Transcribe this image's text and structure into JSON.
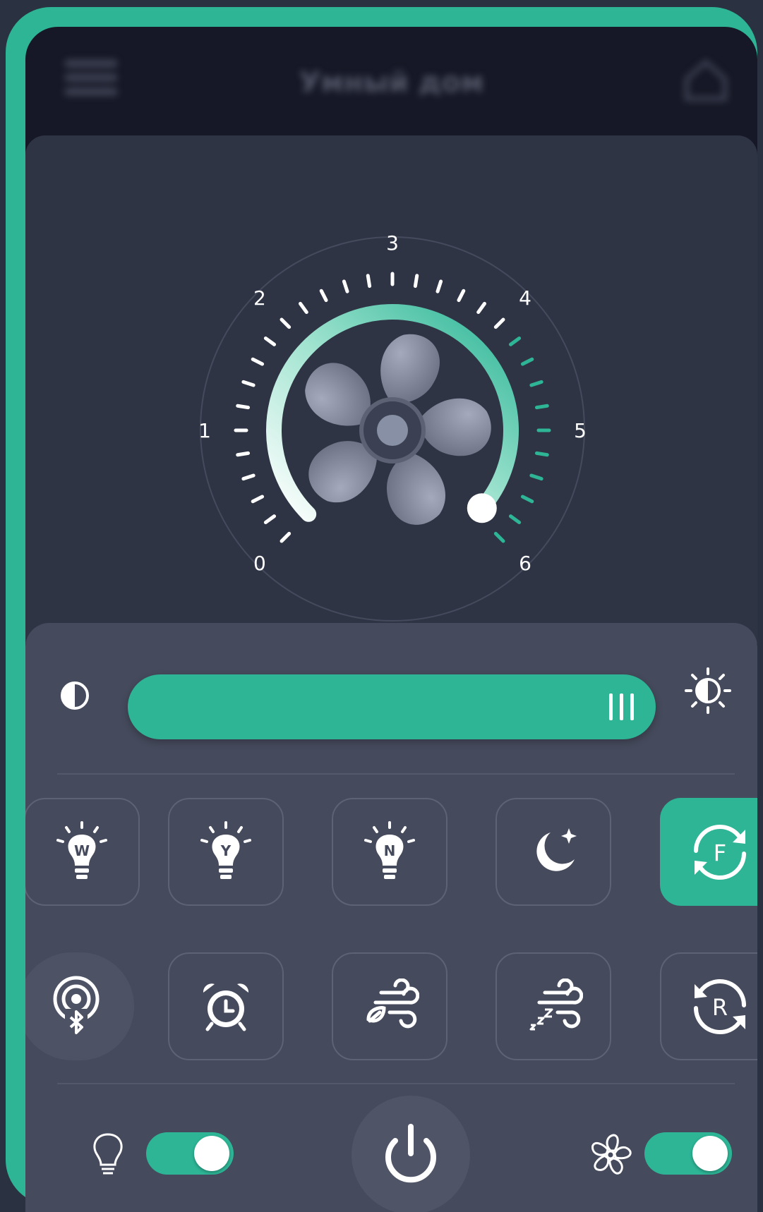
{
  "header": {
    "title": "Умный дом",
    "menu_icon": "hamburger-menu-icon",
    "home_icon": "home-icon"
  },
  "speed_dial": {
    "scale_labels": [
      "0",
      "1",
      "2",
      "3",
      "4",
      "5",
      "6"
    ],
    "min": 0,
    "max": 6,
    "value": 6,
    "center_icon": "fan-icon"
  },
  "brightness": {
    "low_icon": "brightness-low-icon",
    "high_icon": "brightness-high-icon",
    "value_fraction": 1.0
  },
  "mode_buttons_row1": [
    {
      "name": "light-w-button",
      "icon": "bulb-icon",
      "label": "W"
    },
    {
      "name": "light-y-button",
      "icon": "bulb-icon",
      "label": "Y"
    },
    {
      "name": "light-n-button",
      "icon": "bulb-icon",
      "label": "N"
    },
    {
      "name": "night-mode-button",
      "icon": "moon-star-icon",
      "label": ""
    },
    {
      "name": "forward-rotation-button",
      "icon": "rotate-icon",
      "label": "F",
      "active": true
    }
  ],
  "mode_buttons_row2": [
    {
      "name": "bluetooth-button",
      "icon": "bluetooth-signal-icon"
    },
    {
      "name": "timer-button",
      "icon": "alarm-clock-icon"
    },
    {
      "name": "natural-wind-button",
      "icon": "leaf-wind-icon"
    },
    {
      "name": "sleep-wind-button",
      "icon": "sleep-wind-icon"
    },
    {
      "name": "reverse-rotation-button",
      "icon": "rotate-icon",
      "label": "R"
    }
  ],
  "footer": {
    "light_toggle_on": true,
    "fan_toggle_on": true,
    "light_icon": "lightbulb-outline-icon",
    "fan_icon": "fan-outline-icon",
    "power_icon": "power-icon"
  },
  "colors": {
    "accent": "#2db596",
    "panel_dark": "#2f3445",
    "panel_light": "#454a5c"
  }
}
